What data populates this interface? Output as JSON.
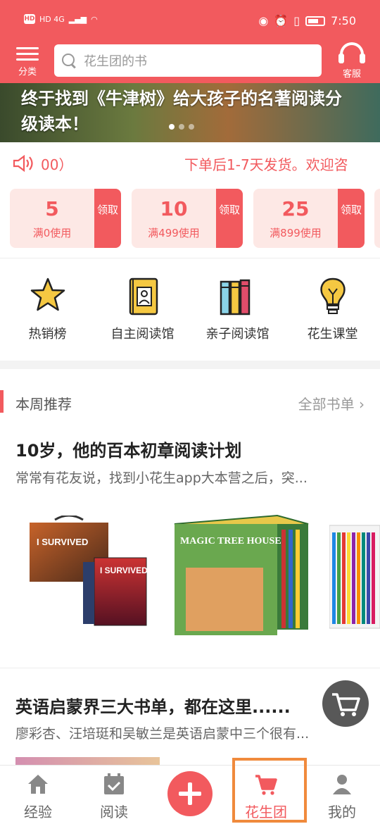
{
  "status": {
    "network": "HD 4G",
    "time": "7:50"
  },
  "header": {
    "menu_label": "分类",
    "search_placeholder": "花生团的书",
    "service_label": "客服"
  },
  "banner": {
    "text": "终于找到《牛津树》给大孩子的名著阅读分级读本！"
  },
  "notice": {
    "left_text": "00）",
    "right_text": "下单后1-7天发货。欢迎咨"
  },
  "coupons": [
    {
      "amount": "5",
      "condition": "满0使用",
      "get_label": "领取"
    },
    {
      "amount": "10",
      "condition": "满499使用",
      "get_label": "领取"
    },
    {
      "amount": "25",
      "condition": "满899使用",
      "get_label": "领取"
    }
  ],
  "categories": [
    {
      "label": "热销榜",
      "icon": "star-icon"
    },
    {
      "label": "自主阅读馆",
      "icon": "book-person-icon"
    },
    {
      "label": "亲子阅读馆",
      "icon": "books-icon"
    },
    {
      "label": "花生课堂",
      "icon": "bulb-icon"
    }
  ],
  "section": {
    "title": "本周推荐",
    "more": "全部书单"
  },
  "articles": [
    {
      "title": "10岁，他的百本初章阅读计划",
      "desc": "常常有花友说，找到小花生app大本营之后，突..."
    },
    {
      "title": "英语启蒙界三大书单，都在这里......",
      "desc": "廖彩杏、汪培珽和吴敏兰是英语启蒙中三个很有..."
    }
  ],
  "books": [
    {
      "title_text": "I SURVIVED"
    },
    {
      "title_text": "MAGIC TREE HOUSE"
    },
    {
      "title_text": ""
    }
  ],
  "nav": [
    {
      "label": "经验",
      "icon": "home-icon"
    },
    {
      "label": "阅读",
      "icon": "calendar-check-icon"
    },
    {
      "label": "",
      "icon": "plus-icon"
    },
    {
      "label": "花生团",
      "icon": "cart-icon"
    },
    {
      "label": "我的",
      "icon": "user-icon"
    }
  ],
  "colors": {
    "accent": "#f25a5e",
    "coupon_bg": "#fde8e5",
    "highlight": "#f08a3c"
  }
}
